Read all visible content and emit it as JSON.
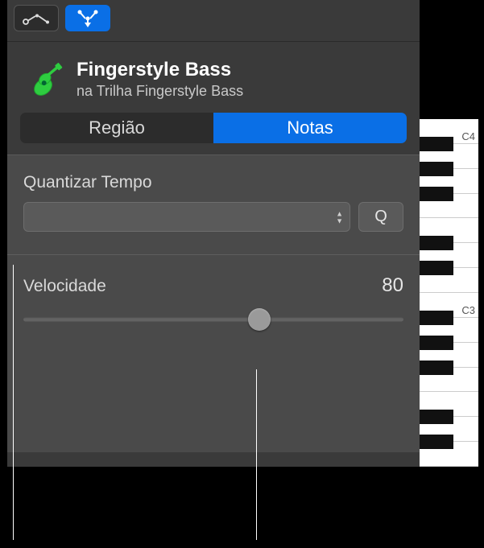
{
  "header": {
    "title": "Fingerstyle Bass",
    "subtitle": "na Trilha Fingerstyle Bass"
  },
  "tabs": {
    "region": "Região",
    "notes": "Notas"
  },
  "quantize": {
    "label": "Quantizar Tempo",
    "selected": "",
    "button": "Q"
  },
  "velocity": {
    "label": "Velocidade",
    "value": "80",
    "percent": 62
  },
  "keys": {
    "c4": "C4",
    "c3": "C3"
  }
}
